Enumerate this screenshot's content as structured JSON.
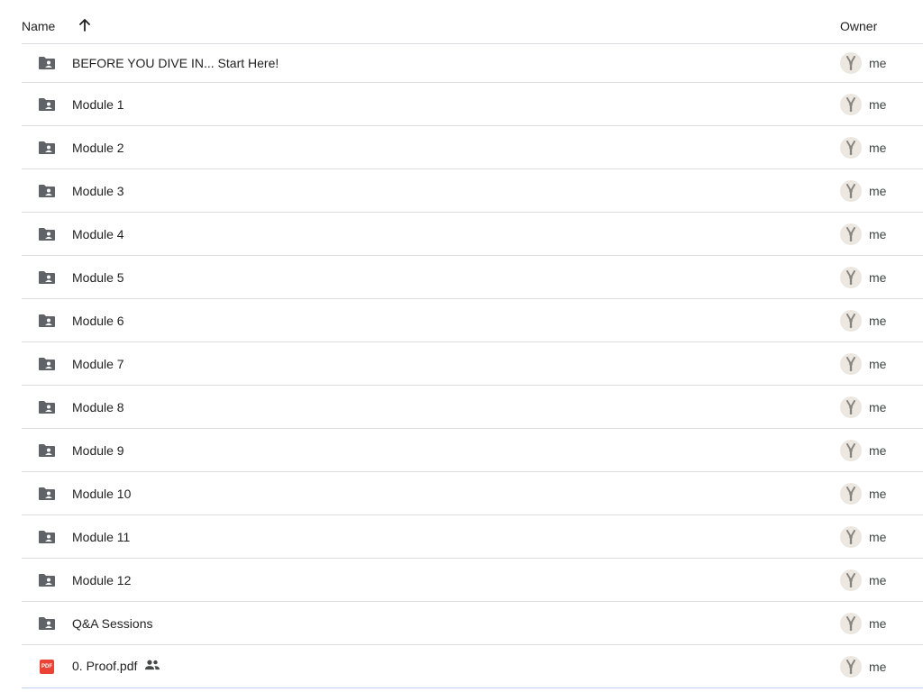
{
  "header": {
    "name_label": "Name",
    "owner_label": "Owner",
    "sort_direction": "ascending"
  },
  "files": [
    {
      "name": "BEFORE YOU DIVE IN... Start Here!",
      "type": "shared-folder",
      "owner": "me",
      "shared": false
    },
    {
      "name": "Module 1",
      "type": "shared-folder",
      "owner": "me",
      "shared": false
    },
    {
      "name": "Module 2",
      "type": "shared-folder",
      "owner": "me",
      "shared": false
    },
    {
      "name": "Module 3",
      "type": "shared-folder",
      "owner": "me",
      "shared": false
    },
    {
      "name": "Module 4",
      "type": "shared-folder",
      "owner": "me",
      "shared": false
    },
    {
      "name": "Module 5",
      "type": "shared-folder",
      "owner": "me",
      "shared": false
    },
    {
      "name": "Module 6",
      "type": "shared-folder",
      "owner": "me",
      "shared": false
    },
    {
      "name": "Module 7",
      "type": "shared-folder",
      "owner": "me",
      "shared": false
    },
    {
      "name": "Module 8",
      "type": "shared-folder",
      "owner": "me",
      "shared": false
    },
    {
      "name": "Module 9",
      "type": "shared-folder",
      "owner": "me",
      "shared": false
    },
    {
      "name": "Module 10",
      "type": "shared-folder",
      "owner": "me",
      "shared": false
    },
    {
      "name": "Module 11",
      "type": "shared-folder",
      "owner": "me",
      "shared": false
    },
    {
      "name": "Module 12",
      "type": "shared-folder",
      "owner": "me",
      "shared": false
    },
    {
      "name": "Q&A Sessions",
      "type": "shared-folder",
      "owner": "me",
      "shared": false
    },
    {
      "name": "0. Proof.pdf",
      "type": "pdf",
      "owner": "me",
      "shared": true,
      "badge": "PDF"
    }
  ],
  "icons": {
    "folder": "shared-folder-icon",
    "pdf": "pdf-icon",
    "shared": "people-icon",
    "sort": "arrow-up-icon",
    "avatar": "owner-avatar"
  },
  "colors": {
    "folder": "#5f6368",
    "pdf": "#ea4335",
    "divider": "#dadce0",
    "avatar_bg": "#ece7e1"
  }
}
